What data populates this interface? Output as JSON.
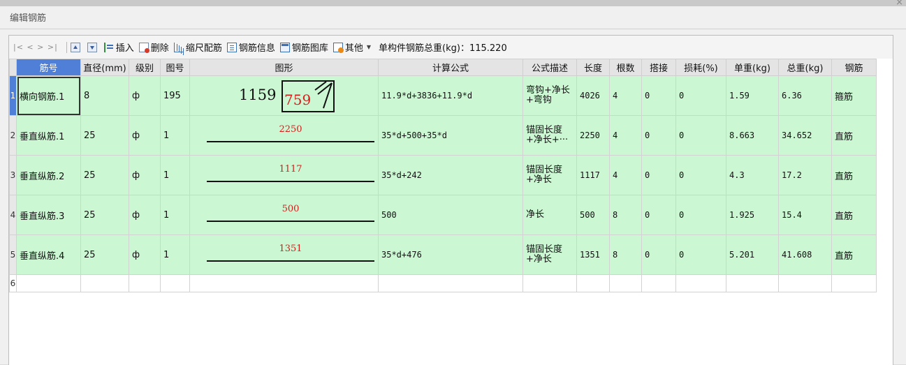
{
  "window": {
    "title": "编辑钢筋",
    "close": "×"
  },
  "toolbar": {
    "nav": "|< < > >|",
    "insert": "插入",
    "delete": "删除",
    "scale": "缩尺配筋",
    "info": "钢筋信息",
    "library": "钢筋图库",
    "other": "其他",
    "weight_label": "单构件钢筋总重(kg)：",
    "weight_value": "115.220"
  },
  "icons": [
    "move-up-icon",
    "move-down-icon",
    "insert-icon",
    "delete-icon",
    "scale-icon",
    "info-icon",
    "library-icon",
    "other-icon",
    "dropdown-icon"
  ],
  "table": {
    "headers": [
      "筋号",
      "直径(mm)",
      "级别",
      "图号",
      "图形",
      "计算公式",
      "公式描述",
      "长度",
      "根数",
      "搭接",
      "损耗(%)",
      "单重(kg)",
      "总重(kg)",
      "钢筋"
    ],
    "rows": [
      {
        "num": "1",
        "name": "横向钢筋.1",
        "dia": "8",
        "grade": "ф",
        "fig": "195",
        "shape_a": "1159",
        "shape_b": "759",
        "formula": "11.9*d+3836+11.9*d",
        "desc": "弯钩+净长+弯钩",
        "len": "4026",
        "count": "4",
        "lap": "0",
        "loss": "0",
        "unit": "1.59",
        "total": "6.36",
        "type": "箍筋"
      },
      {
        "num": "2",
        "name": "垂直纵筋.1",
        "dia": "25",
        "grade": "ф",
        "fig": "1",
        "shape": "2250",
        "formula": "35*d+500+35*d",
        "desc": "锚固长度+净长+···",
        "len": "2250",
        "count": "4",
        "lap": "0",
        "loss": "0",
        "unit": "8.663",
        "total": "34.652",
        "type": "直筋"
      },
      {
        "num": "3",
        "name": "垂直纵筋.2",
        "dia": "25",
        "grade": "ф",
        "fig": "1",
        "shape": "1117",
        "formula": "35*d+242",
        "desc": "锚固长度+净长",
        "len": "1117",
        "count": "4",
        "lap": "0",
        "loss": "0",
        "unit": "4.3",
        "total": "17.2",
        "type": "直筋"
      },
      {
        "num": "4",
        "name": "垂直纵筋.3",
        "dia": "25",
        "grade": "ф",
        "fig": "1",
        "shape": "500",
        "formula": "500",
        "desc": "净长",
        "len": "500",
        "count": "8",
        "lap": "0",
        "loss": "0",
        "unit": "1.925",
        "total": "15.4",
        "type": "直筋"
      },
      {
        "num": "5",
        "name": "垂直纵筋.4",
        "dia": "25",
        "grade": "ф",
        "fig": "1",
        "shape": "1351",
        "formula": "35*d+476",
        "desc": "锚固长度+净长",
        "len": "1351",
        "count": "8",
        "lap": "0",
        "loss": "0",
        "unit": "5.201",
        "total": "41.608",
        "type": "直筋"
      }
    ],
    "empty_row_num": "6"
  }
}
